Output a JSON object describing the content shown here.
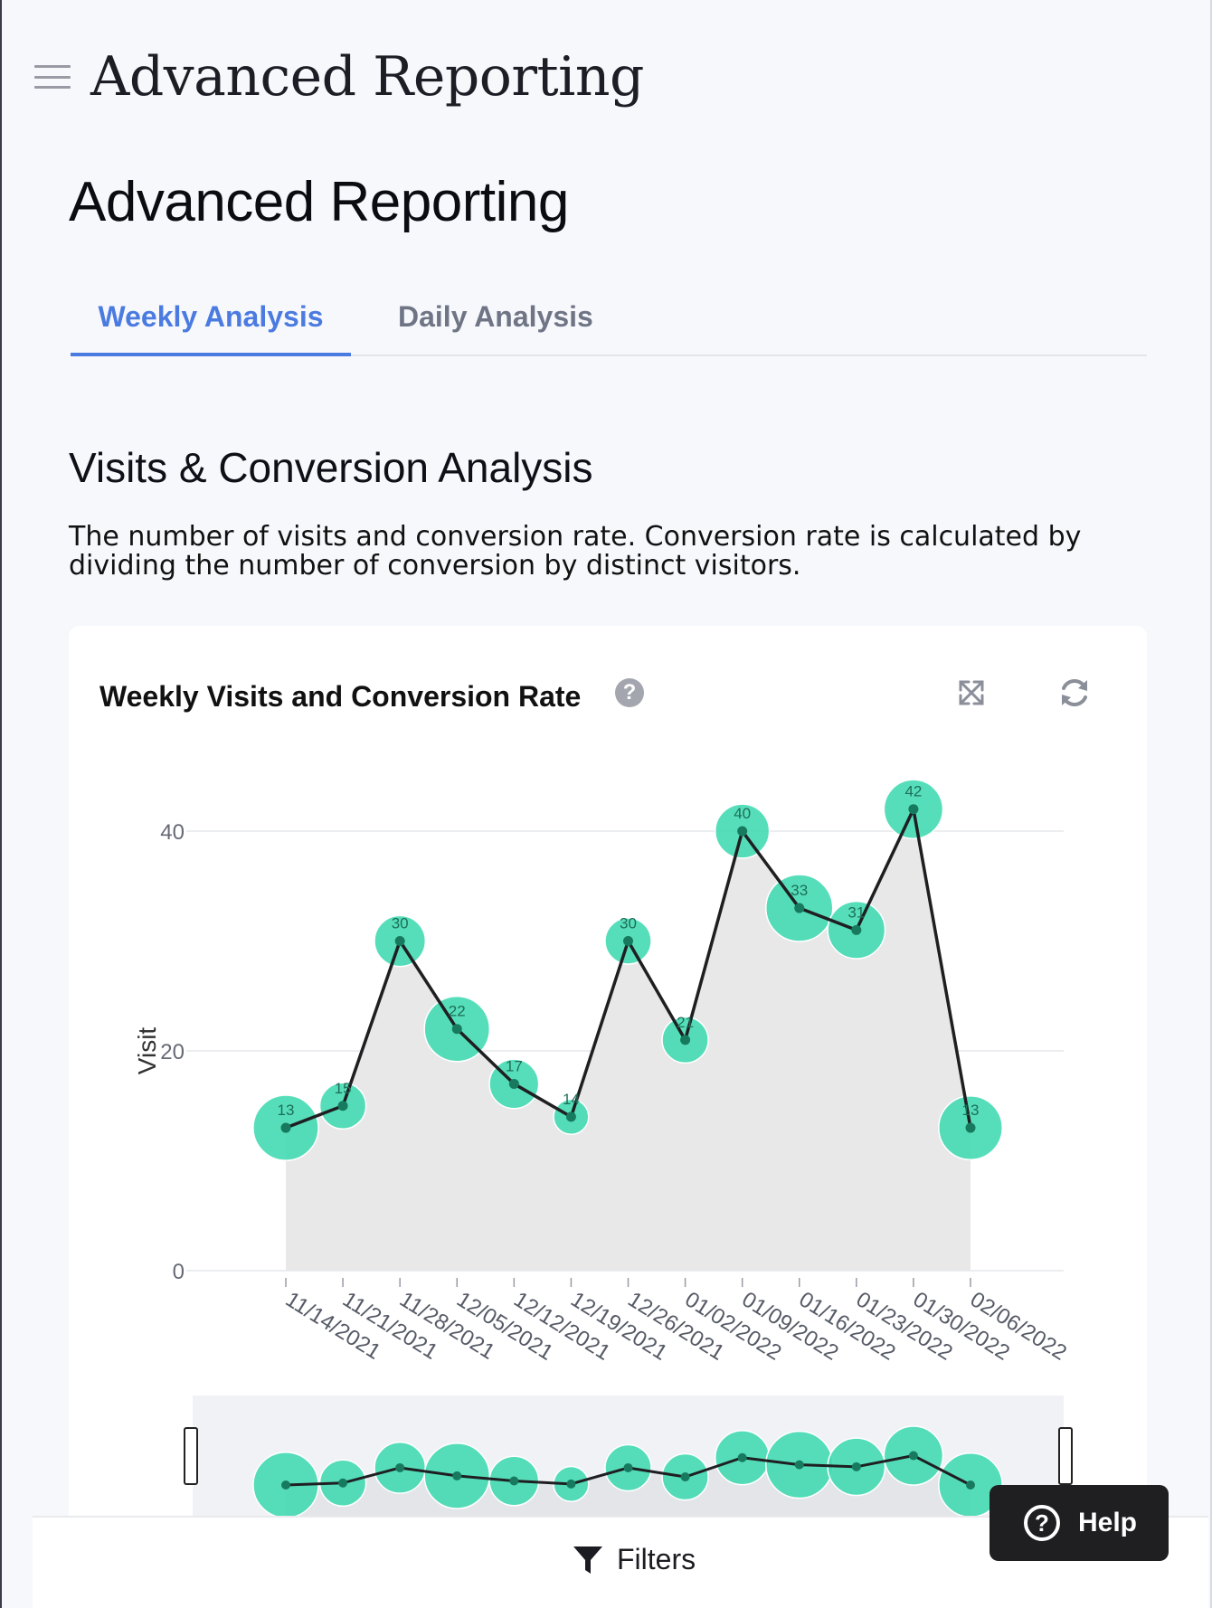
{
  "app": {
    "title": "Advanced Reporting"
  },
  "page": {
    "title": "Advanced Reporting"
  },
  "tabs": [
    {
      "label": "Weekly Analysis",
      "active": true
    },
    {
      "label": "Daily Analysis",
      "active": false
    }
  ],
  "section": {
    "title": "Visits & Conversion Analysis",
    "description": "The number of visits and conversion rate. Conversion rate is calculated by dividing the number of conversion by distinct visitors."
  },
  "card": {
    "title": "Weekly Visits and Conversion Rate",
    "help_icon": "question-circle-icon",
    "expand_icon": "expand-icon",
    "refresh_icon": "refresh-icon"
  },
  "bottom": {
    "filters_label": "Filters",
    "filters_icon": "funnel-icon"
  },
  "help_button": {
    "label": "Help",
    "icon": "question-circle-icon"
  },
  "colors": {
    "accent": "#4b7be0",
    "bubble": "#3fd9b0",
    "line": "#1f1f22",
    "area": "#e8e8e8"
  },
  "chart_data": {
    "type": "line",
    "x": [
      "11/14/2021",
      "11/21/2021",
      "11/28/2021",
      "12/05/2021",
      "12/12/2021",
      "12/19/2021",
      "12/26/2021",
      "01/02/2022",
      "01/09/2022",
      "01/16/2022",
      "01/23/2022",
      "01/30/2022",
      "02/06/2022"
    ],
    "series": [
      {
        "values": [
          13,
          15,
          30,
          22,
          17,
          14,
          30,
          21,
          40,
          33,
          31,
          42,
          13
        ]
      }
    ],
    "bubble_size": [
      0.82,
      0.58,
      0.64,
      0.82,
      0.62,
      0.44,
      0.58,
      0.58,
      0.68,
      0.84,
      0.72,
      0.74,
      0.8
    ],
    "ylabel": "Visit",
    "yticks": [
      0,
      20,
      40
    ],
    "ylim": [
      0,
      44
    ],
    "grid": true,
    "area_fill": true,
    "has_range_slider": true
  }
}
